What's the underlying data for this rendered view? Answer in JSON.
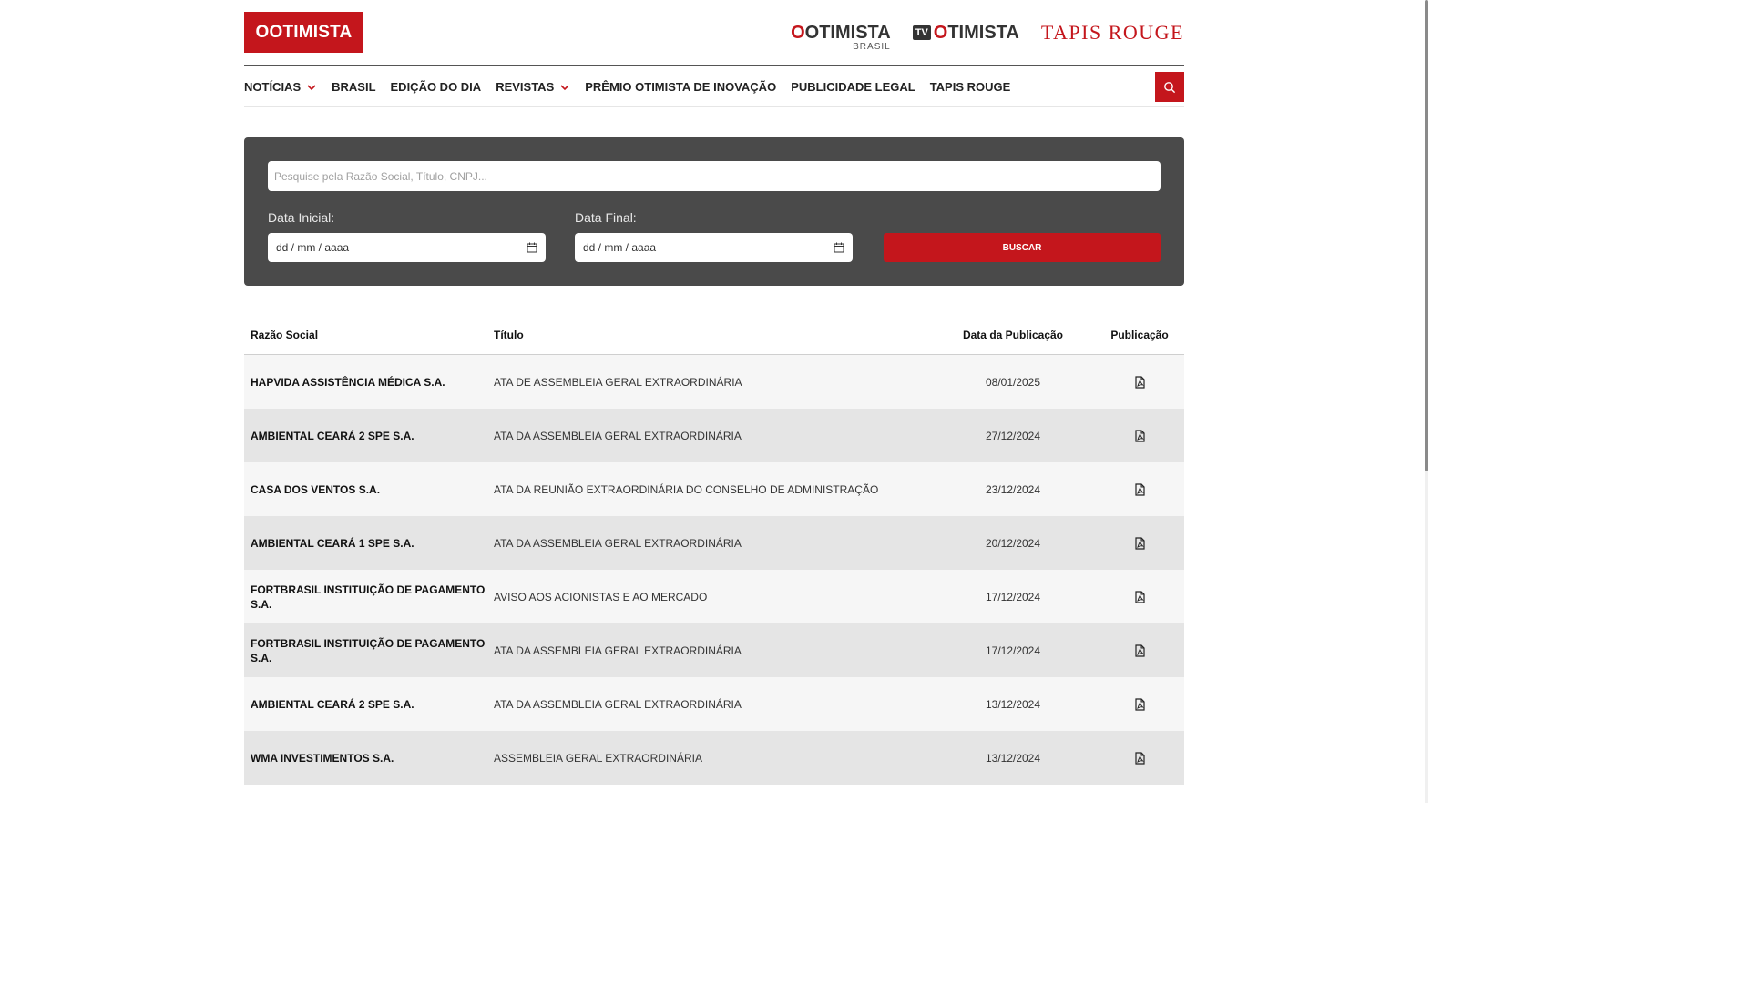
{
  "header": {
    "logo_text": "OOTIMISTA",
    "brands": {
      "otimista_brasil": {
        "o": "O",
        "name": "OTIMISTA",
        "sub": "BRASIL"
      },
      "tv_otimista": {
        "tv": "TV",
        "o": "O",
        "name": "TIMISTA"
      },
      "tapis_rouge": "TAPIS ROUGE"
    }
  },
  "nav": {
    "items": [
      {
        "label": "NOTÍCIAS",
        "dropdown": true
      },
      {
        "label": "BRASIL"
      },
      {
        "label": "EDIÇÃO DO DIA"
      },
      {
        "label": "REVISTAS",
        "dropdown": true
      },
      {
        "label": "PRÊMIO OTIMISTA DE INOVAÇÃO"
      },
      {
        "label": "PUBLICIDADE LEGAL"
      },
      {
        "label": "TAPIS ROUGE"
      }
    ]
  },
  "search": {
    "placeholder": "Pesquise pela Razão Social, Título, CNPJ...",
    "date_start_label": "Data Inicial:",
    "date_end_label": "Data Final:",
    "date_placeholder": "dd / mm / aaaa",
    "button_label": "BUSCAR"
  },
  "table": {
    "headers": [
      "Razão Social",
      "Título",
      "Data da Publicação",
      "Publicação"
    ],
    "rows": [
      {
        "razao": "HAPVIDA ASSISTÊNCIA MÉDICA S.A.",
        "titulo": "ATA DE ASSEMBLEIA GERAL EXTRAORDINÁRIA",
        "data": "08/01/2025"
      },
      {
        "razao": "AMBIENTAL CEARÁ 2 SPE S.A.",
        "titulo": "ATA DA ASSEMBLEIA GERAL EXTRAORDINÁRIA",
        "data": "27/12/2024"
      },
      {
        "razao": "CASA DOS VENTOS S.A.",
        "titulo": "ATA DA REUNIÃO EXTRAORDINÁRIA DO CONSELHO DE ADMINISTRAÇÃO",
        "data": "23/12/2024"
      },
      {
        "razao": "AMBIENTAL CEARÁ 1 SPE S.A.",
        "titulo": "ATA DA ASSEMBLEIA GERAL EXTRAORDINÁRIA",
        "data": "20/12/2024"
      },
      {
        "razao": "FORTBRASIL INSTITUIÇÃO DE PAGAMENTO S.A.",
        "titulo": "AVISO AOS ACIONISTAS E AO MERCADO",
        "data": "17/12/2024"
      },
      {
        "razao": "FORTBRASIL INSTITUIÇÃO DE PAGAMENTO S.A.",
        "titulo": "ATA DA ASSEMBLEIA GERAL EXTRAORDINÁRIA",
        "data": "17/12/2024"
      },
      {
        "razao": "AMBIENTAL CEARÁ 2 SPE S.A.",
        "titulo": "ATA DA ASSEMBLEIA GERAL EXTRAORDINÁRIA",
        "data": "13/12/2024"
      },
      {
        "razao": "WMA INVESTIMENTOS S.A.",
        "titulo": "ASSEMBLEIA GERAL EXTRAORDINÁRIA",
        "data": "13/12/2024"
      }
    ],
    "row_icon": "pdf-file-icon"
  },
  "colors": {
    "brand_red": "#c4161c",
    "panel_bg": "#4a4a4a",
    "row_light": "#f6f6f6",
    "row_dark": "#e5e5e5"
  }
}
